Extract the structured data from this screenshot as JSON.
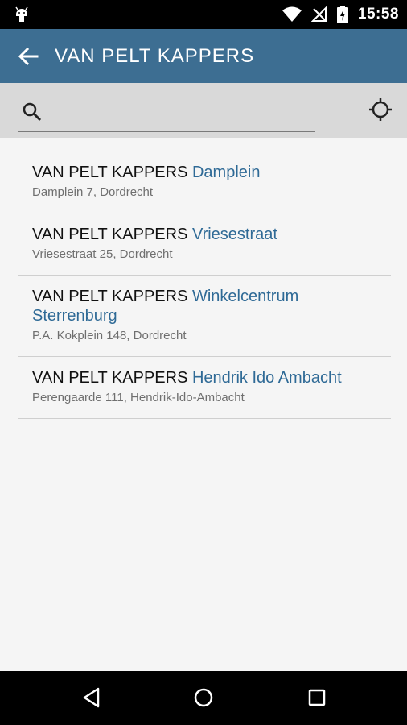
{
  "status_bar": {
    "time": "15:58",
    "icons": [
      "android-debug-icon",
      "wifi-icon",
      "no-signal-icon",
      "battery-charging-icon"
    ]
  },
  "app_bar": {
    "title": "VAN PELT KAPPERS",
    "background": "#3d6e92",
    "back_icon": "arrow-left-icon"
  },
  "search": {
    "placeholder": "",
    "value": "",
    "search_icon": "magnifier-icon",
    "locate_icon": "crosshair-location-icon"
  },
  "locations": [
    {
      "brand": "VAN PELT KAPPERS",
      "branch": "Damplein",
      "address": "Damplein 7, Dordrecht"
    },
    {
      "brand": "VAN PELT KAPPERS",
      "branch": "Vriesestraat",
      "address": "Vriesestraat 25, Dordrecht"
    },
    {
      "brand": "VAN PELT KAPPERS",
      "branch": "Winkelcentrum Sterrenburg",
      "address": "P.A. Kokplein 148, Dordrecht"
    },
    {
      "brand": "VAN PELT KAPPERS",
      "branch": "Hendrik Ido Ambacht",
      "address": "Perengaarde 111, Hendrik-Ido-Ambacht"
    }
  ],
  "colors": {
    "accent": "#2f6a96",
    "status_bar": "#000000",
    "nav_bar": "#000000"
  },
  "nav_bar": {
    "icons": [
      "back-triangle-icon",
      "home-circle-icon",
      "recents-square-icon"
    ]
  }
}
